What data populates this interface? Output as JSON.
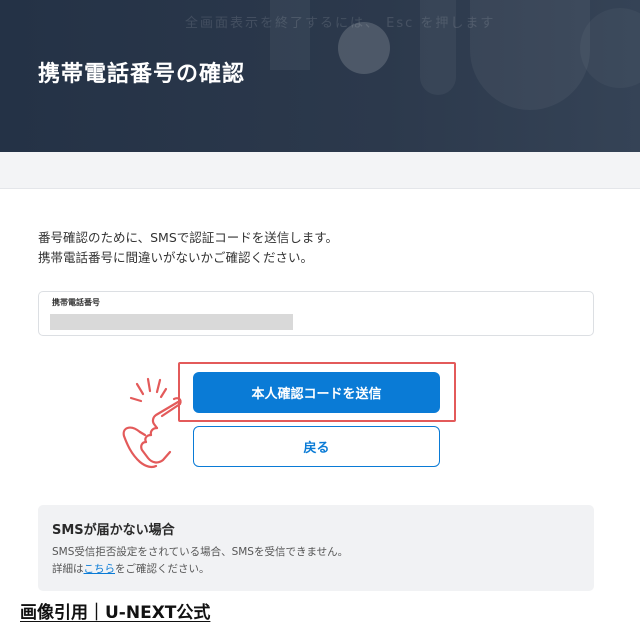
{
  "header": {
    "title": "携帯電話番号の確認",
    "faint_text": "全画面表示を終了するには、 Esc を押します"
  },
  "description": {
    "line1": "番号確認のために、SMSで認証コードを送信します。",
    "line2": "携帯電話番号に間違いがないかご確認ください。"
  },
  "phone_field": {
    "label": "携帯電話番号"
  },
  "buttons": {
    "send_label": "本人確認コードを送信",
    "back_label": "戻る"
  },
  "sms_help": {
    "heading": "SMSが届かない場合",
    "line1": "SMS受信拒否設定をされている場合、SMSを受信できません。",
    "line2_prefix": "詳細は",
    "line2_link": "こちら",
    "line2_suffix": "をご確認ください。"
  },
  "caption": "画像引用｜U-NEXT公式",
  "colors": {
    "header_bg": "#2c394c",
    "accent": "#0a7bd6",
    "highlight": "#e35a5a"
  },
  "icons": [
    "pointing-hand-icon"
  ]
}
